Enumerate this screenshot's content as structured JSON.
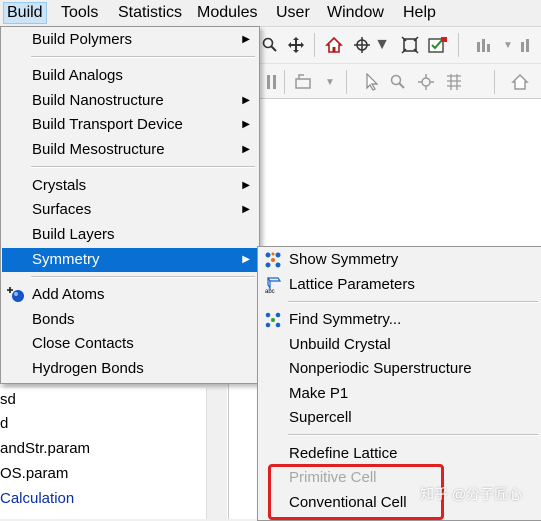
{
  "menubar": {
    "items": [
      "Build",
      "Tools",
      "Statistics",
      "Modules",
      "User",
      "Window",
      "Help"
    ]
  },
  "toolbar": {
    "row1_icons": [
      "search-zoom-icon",
      "move-cross-icon",
      "home-icon",
      "target-icon",
      "fit-window-icon",
      "check-dialog-icon",
      "bar-chart-icon",
      "dropdown-icon"
    ],
    "row2_icons": [
      "column-icon",
      "shape-dropdown-icon",
      "pointer-icon",
      "magnifier-icon",
      "move-icon",
      "grid-icon",
      "home-icon"
    ]
  },
  "build_menu": {
    "items": [
      {
        "label": "Build Polymers",
        "submenu": true
      },
      {
        "label": "Build Analogs",
        "submenu": false
      },
      {
        "label": "Build Nanostructure",
        "submenu": true
      },
      {
        "label": "Build Transport Device",
        "submenu": true
      },
      {
        "label": "Build Mesostructure",
        "submenu": true
      },
      {
        "label": "Crystals",
        "submenu": true
      },
      {
        "label": "Surfaces",
        "submenu": true
      },
      {
        "label": "Build Layers",
        "submenu": false
      },
      {
        "label": "Symmetry",
        "submenu": true,
        "highlighted": true
      },
      {
        "label": "Add Atoms",
        "submenu": false
      },
      {
        "label": "Bonds",
        "submenu": false
      },
      {
        "label": "Close Contacts",
        "submenu": false
      },
      {
        "label": "Hydrogen Bonds",
        "submenu": false
      }
    ]
  },
  "symmetry_menu": {
    "items": [
      {
        "label": "Show Symmetry",
        "icon": "show-symmetry-icon"
      },
      {
        "label": "Lattice Parameters",
        "icon": "lattice-abc-icon"
      },
      {
        "label": "Find Symmetry...",
        "icon": "find-symmetry-icon"
      },
      {
        "label": "Unbuild Crystal"
      },
      {
        "label": "Nonperiodic Superstructure"
      },
      {
        "label": "Make P1"
      },
      {
        "label": "Supercell"
      },
      {
        "label": "Redefine Lattice"
      },
      {
        "label": "Primitive Cell",
        "disabled": true
      },
      {
        "label": "Conventional Cell"
      }
    ]
  },
  "tree": {
    "rows": [
      "sd",
      "d",
      "andStr.param",
      "OS.param",
      "Calculation"
    ]
  },
  "watermark": "知乎 @分子匠心",
  "colors": {
    "highlight": "#0a6fd2",
    "annotation_box": "#e02020",
    "disabled_text": "#a7a7a7"
  }
}
